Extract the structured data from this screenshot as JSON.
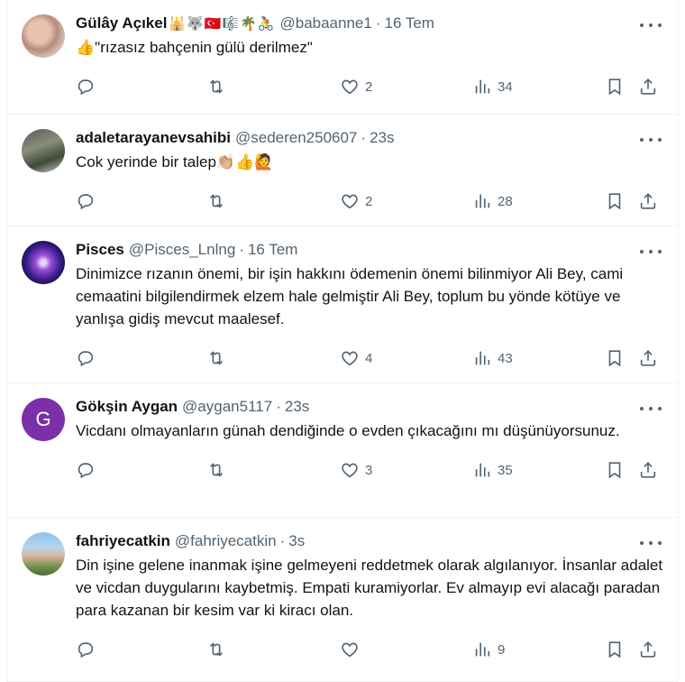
{
  "tweets": [
    {
      "name": "Gülây Açıkel",
      "emojis": "🕌🐺🇹🇷🎼🌴🚴",
      "handle": "@babaanne1",
      "time": "16 Tem",
      "text": "👍\"rızasız bahçenin gülü derilmez\"",
      "replies": "",
      "retweets": "",
      "likes": "2",
      "views": "34",
      "avatar": "photo"
    },
    {
      "name": "adaletarayanevsahibi",
      "emojis": "",
      "handle": "@sederen250607",
      "time": "23s",
      "text": "Cok yerinde bir talep👏🏼👍🙋",
      "replies": "",
      "retweets": "",
      "likes": "2",
      "views": "28",
      "avatar": "photo"
    },
    {
      "name": "Pisces",
      "emojis": "",
      "handle": "@Pisces_Lnlng",
      "time": "16 Tem",
      "text": "Dinimizce rızanın önemi, bir işin hakkını ödemenin önemi bilinmiyor Ali Bey, cami cemaatini bilgilendirmek elzem hale gelmiştir Ali Bey, toplum bu yönde kötüye ve yanlışa gidiş mevcut maalesef.",
      "replies": "",
      "retweets": "",
      "likes": "4",
      "views": "43",
      "avatar": "photo"
    },
    {
      "name": "Gökşin Aygan",
      "emojis": "",
      "handle": "@aygan5117",
      "time": "23s",
      "text": "Vicdanı olmayanların günah dendiğinde o evden çıkacağını mı düşünüyorsunuz.",
      "replies": "",
      "retweets": "",
      "likes": "3",
      "views": "35",
      "avatar": "G"
    },
    {
      "name": "fahriyecatkin",
      "emojis": "",
      "handle": "@fahriyecatkin",
      "time": "3s",
      "text": "Din işine gelene inanmak işine gelmeyeni reddetmek olarak algılanıyor. İnsanlar adalet ve vicdan duygularını kaybetmiş. Empati kuramiyorlar. Ev almayıp evi alacağı paradan para kazanan bir kesim var ki kiracı olan.",
      "replies": "",
      "retweets": "",
      "likes": "",
      "views": "9",
      "avatar": "photo"
    }
  ],
  "icons": {
    "reply": "reply-icon",
    "retweet": "retweet-icon",
    "like": "heart-icon",
    "views": "views-icon",
    "bookmark": "bookmark-icon",
    "share": "share-icon",
    "more": "more-icon"
  },
  "colors": {
    "text": "#0f1419",
    "secondary": "#536471",
    "border": "#eff3f4",
    "letter_avatar": "#7b2fa8"
  }
}
